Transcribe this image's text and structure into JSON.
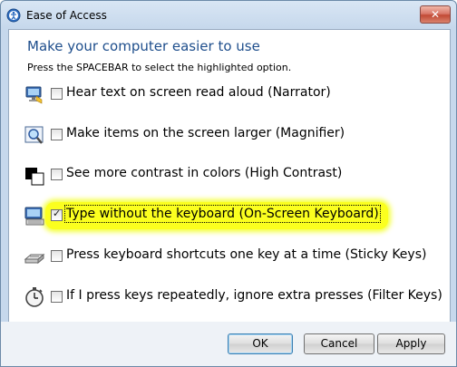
{
  "window": {
    "title": "Ease of Access",
    "close_label": "✕"
  },
  "content": {
    "heading": "Make your computer easier to use",
    "instruction": "Press the SPACEBAR to select the highlighted option."
  },
  "options": [
    {
      "label": "Hear text on screen read aloud (Narrator)",
      "checked": false,
      "icon": "narrator-icon"
    },
    {
      "label": "Make items on the screen larger (Magnifier)",
      "checked": false,
      "icon": "magnifier-icon"
    },
    {
      "label": "See more contrast in colors (High Contrast)",
      "checked": false,
      "icon": "high-contrast-icon"
    },
    {
      "label": "Type without the keyboard (On-Screen Keyboard)",
      "checked": true,
      "icon": "on-screen-keyboard-icon"
    },
    {
      "label": "Press keyboard shortcuts one key at a time (Sticky Keys)",
      "checked": false,
      "icon": "sticky-keys-icon"
    },
    {
      "label": "If I press keys repeatedly, ignore extra presses (Filter Keys)",
      "checked": false,
      "icon": "filter-keys-icon"
    }
  ],
  "buttons": {
    "ok": "OK",
    "cancel": "Cancel",
    "apply": "Apply"
  },
  "colors": {
    "heading": "#1e4e8c",
    "highlight": "#fbff1f"
  }
}
